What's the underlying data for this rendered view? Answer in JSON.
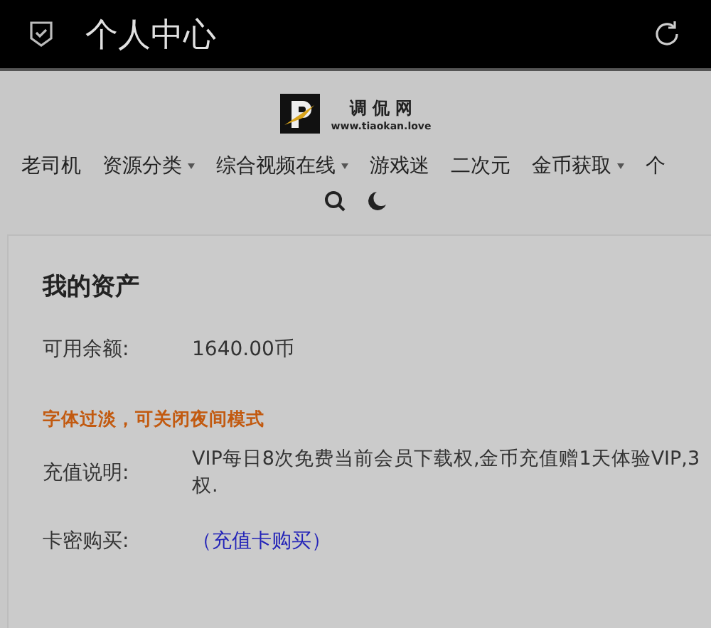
{
  "top_bar": {
    "title": "个人中心"
  },
  "logo": {
    "name": "调 侃 网",
    "url": "www.tiaokan.love"
  },
  "nav": [
    {
      "label": "老司机",
      "has_dropdown": false
    },
    {
      "label": "资源分类",
      "has_dropdown": true
    },
    {
      "label": "综合视频在线",
      "has_dropdown": true
    },
    {
      "label": "游戏迷",
      "has_dropdown": false
    },
    {
      "label": "二次元",
      "has_dropdown": false
    },
    {
      "label": "金币获取",
      "has_dropdown": true
    },
    {
      "label": "个",
      "has_dropdown": false
    }
  ],
  "assets": {
    "title": "我的资产",
    "balance": {
      "label": "可用余额:",
      "value": "1640.00币"
    },
    "notice": "字体过淡，可关闭夜间模式",
    "recharge": {
      "label": "充值说明:",
      "lines": [
        "VIP每日8次免费当前会员下载权,金币充值赠1天体验VIP,3",
        "权."
      ]
    },
    "card": {
      "label": "卡密购买:",
      "link": "（充值卡购买）"
    }
  }
}
